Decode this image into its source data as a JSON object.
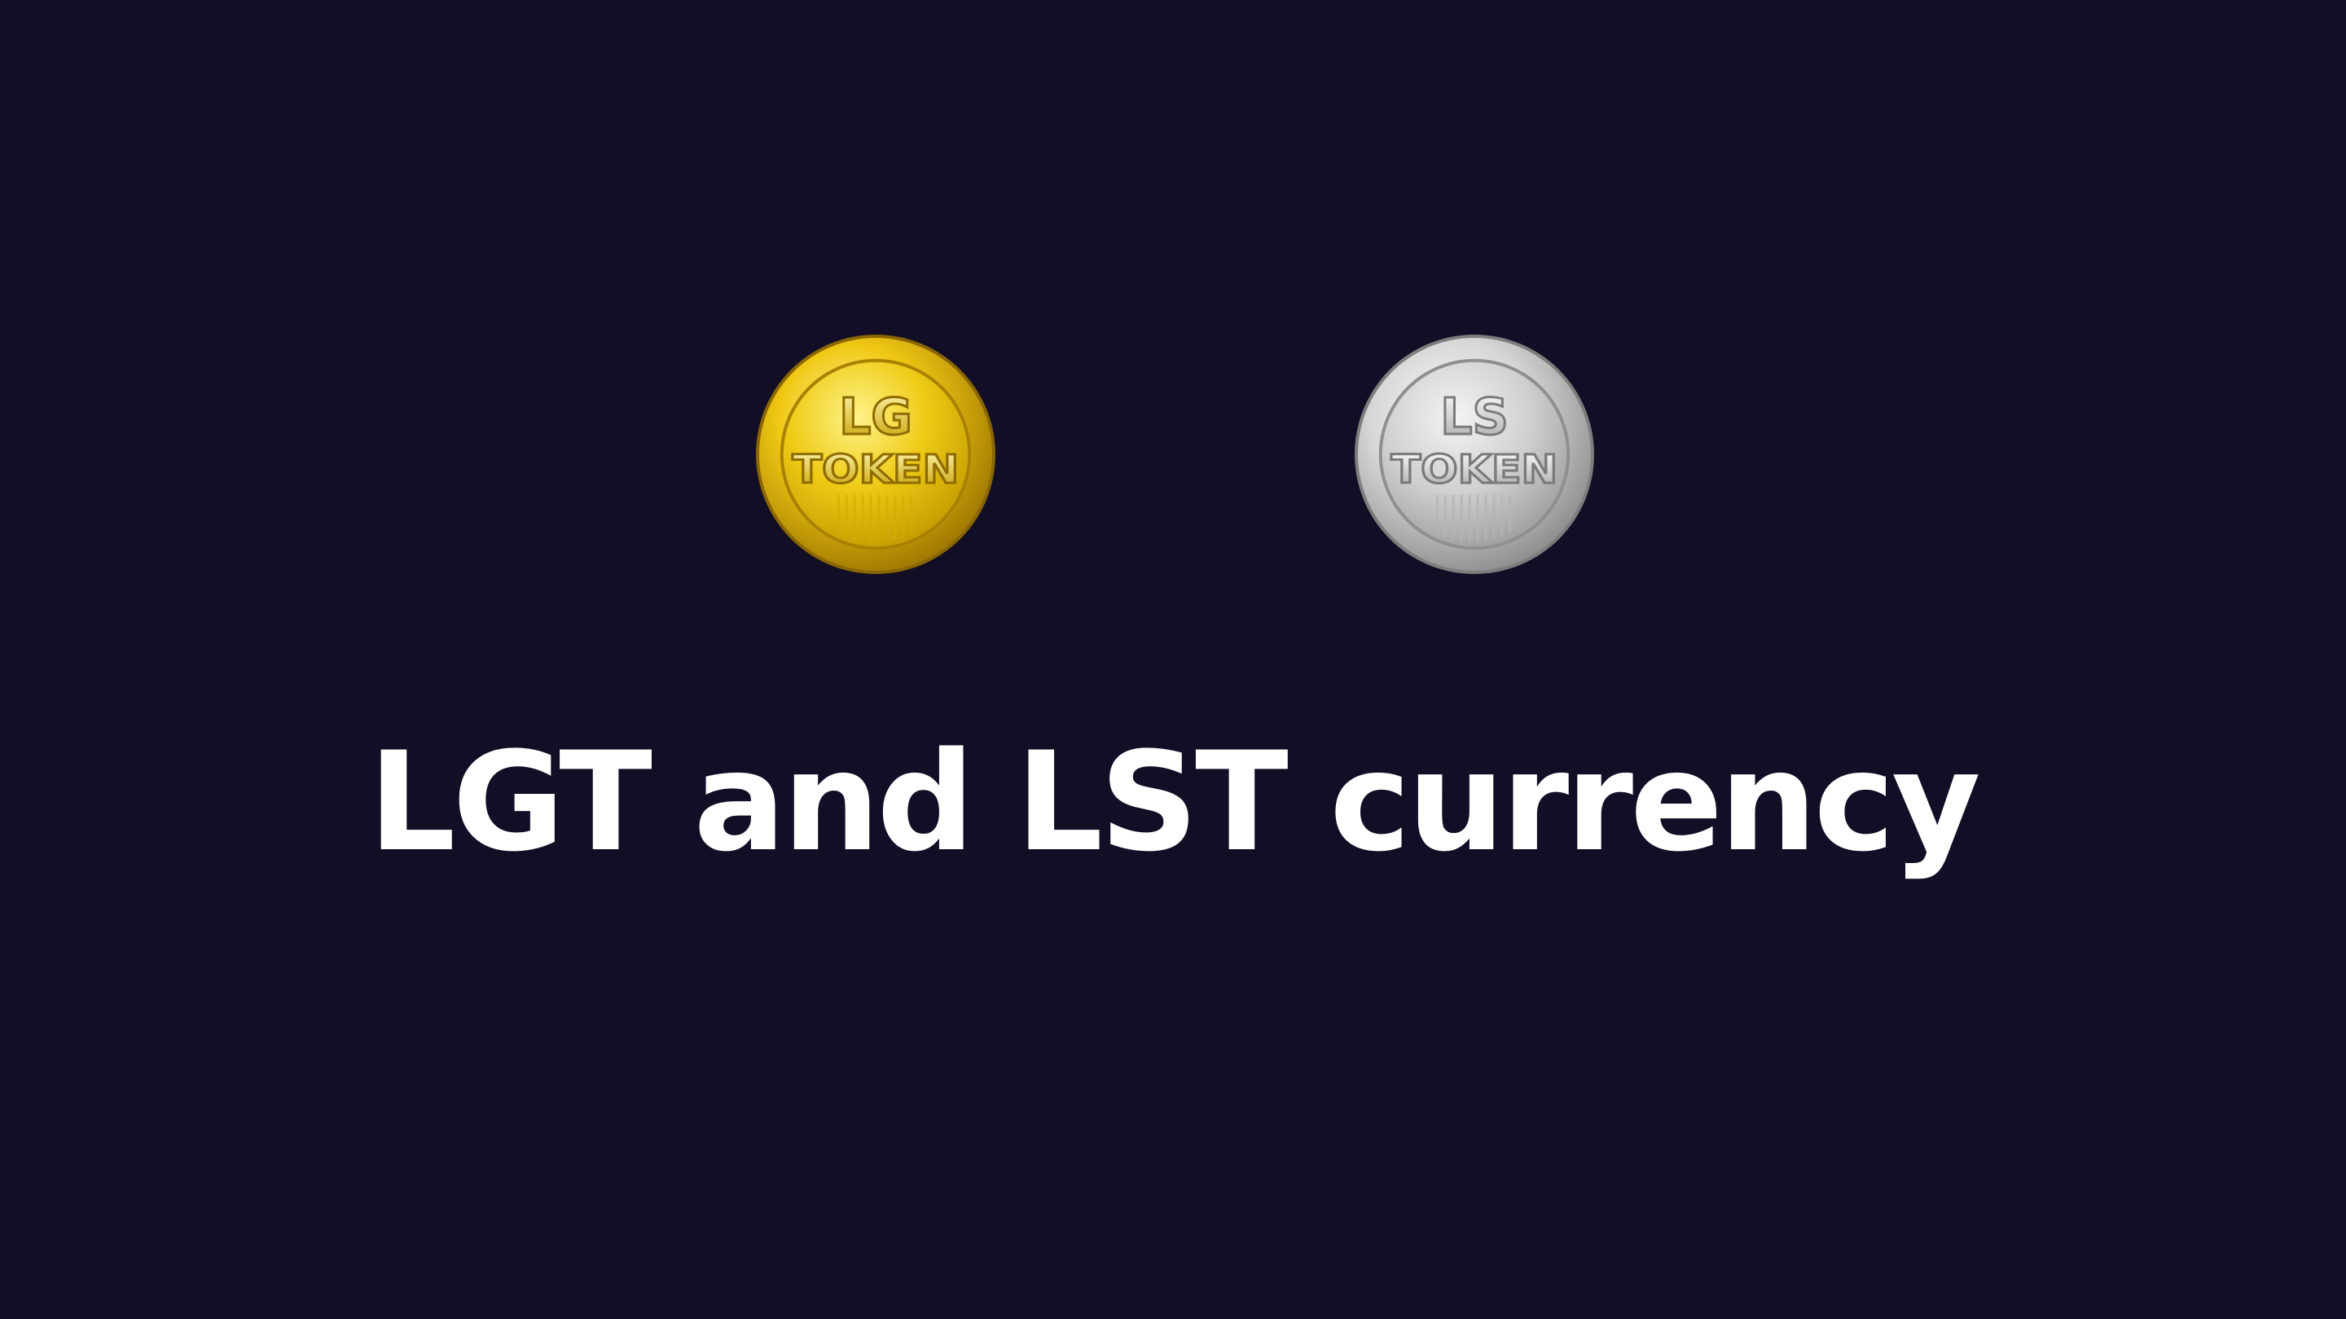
{
  "coins": [
    {
      "line1": "LG",
      "line2": "TOKEN",
      "icon": "gold-token-coin-icon",
      "colors": {
        "rim": "#b88f00",
        "face": "#f2cf1a",
        "highlight": "#fff3a0",
        "text": "#c9a200"
      }
    },
    {
      "line1": "LS",
      "line2": "TOKEN",
      "icon": "silver-token-coin-icon",
      "colors": {
        "rim": "#9a9a9a",
        "face": "#d9d9d9",
        "highlight": "#ffffff",
        "text": "#a8a8a8"
      }
    }
  ],
  "headline": "LGT and LST currency",
  "colors": {
    "background": "#110e26",
    "headline": "#ffffff"
  }
}
